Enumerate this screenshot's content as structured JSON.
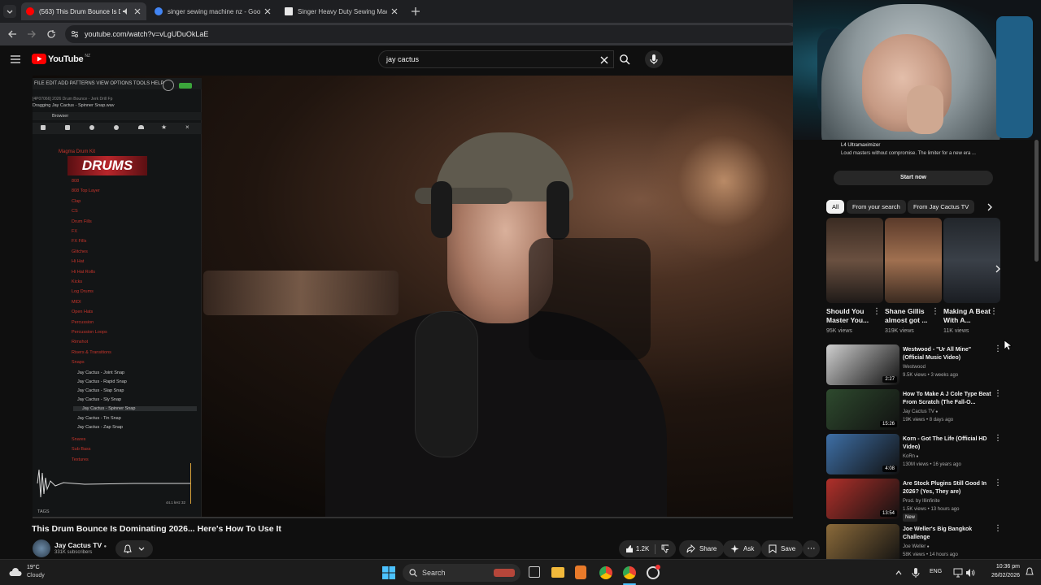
{
  "browser": {
    "tabs": [
      {
        "title": "(563) This Drum Bounce Is D",
        "favicon_color": "#ff0000",
        "active": true
      },
      {
        "title": "singer sewing machine nz - Goo",
        "favicon_color": "#4285f4",
        "active": false
      },
      {
        "title": "Singer Heavy Duty Sewing Mac",
        "favicon_color": "#ffffff",
        "active": false
      }
    ],
    "url": "youtube.com/watch?v=vLgUDuOkLaE"
  },
  "youtube": {
    "logo": "YouTube",
    "region": "NZ",
    "search_value": "jay cactus"
  },
  "daw": {
    "menu": "FILE  EDIT  ADD  PATTERNS  VIEW  OPTIONS  TOOLS  HELP",
    "project": "[4P07066] 2026 Drum Bounce - Jerk Drill Fp",
    "dragging": "Dragging Jay Cactus - Spinner Snap.wav",
    "browser_label": "Browser",
    "kit": "Magma Drum Kit",
    "banner": "DRUMS",
    "folders": [
      "808",
      "808 Top Layer",
      "Clap",
      "CS",
      "Drum Fills",
      "FX",
      "FX Fills",
      "Glitches",
      "Hi Hat",
      "Hi Hat Rolls",
      "Kicks",
      "Log Drums",
      "MIDI",
      "Open Hats",
      "Percussion",
      "Percussion Loops",
      "Rimshot",
      "Risers & Transitions",
      "Snaps"
    ],
    "snaps": [
      "Jay Cactus - Joint Snap",
      "Jay Cactus - Rapid Snap",
      "Jay Cactus - Slap Snap",
      "Jay Cactus - Sly Snap",
      "Jay Cactus - Spinner Snap",
      "Jay Cactus - Tin Snap",
      "Jay Cactus - Zap Snap"
    ],
    "folders_after": [
      "Snares",
      "Sub Bass",
      "Textures"
    ],
    "sample_info": "44.1 kHz 32",
    "tags": "TAGS"
  },
  "ad": {
    "title": "L4 Ultramaximizer",
    "text": "Loud masters without compromise. The limiter for a new era ...",
    "cta": "Start now"
  },
  "chips": [
    "All",
    "From your search",
    "From Jay Cactus TV"
  ],
  "shorts": [
    {
      "title": "Should You Master You...",
      "views": "95K views"
    },
    {
      "title": "Shane Gillis almost got ...",
      "views": "319K views"
    },
    {
      "title": "Making A Beat With A...",
      "views": "11K views"
    }
  ],
  "recommendations": [
    {
      "title": "Westwood - \"Ur All Mine\" (Official Music Video)",
      "channel": "Westwood",
      "meta": "9.5K views • 3 weeks ago",
      "duration": "2:27",
      "thumb_color": "#cfcfcf",
      "verified": false,
      "badge": ""
    },
    {
      "title": "How To Make A J Cole Type Beat From Scratch (The Fall-O...",
      "channel": "Jay Cactus TV",
      "meta": "19K views • 8 days ago",
      "duration": "15:26",
      "thumb_color": "#2e4a2e",
      "verified": true,
      "badge": ""
    },
    {
      "title": "Korn - Got The Life (Official HD Video)",
      "channel": "KoRn",
      "meta": "130M views • 16 years ago",
      "duration": "4:08",
      "thumb_color": "#3e6fa6",
      "verified": true,
      "badge": ""
    },
    {
      "title": "Are Stock Plugins Still Good In 2026? (Yes, They are)",
      "channel": "Prod. by Illinfinite",
      "meta": "1.5K views • 13 hours ago",
      "duration": "13:54",
      "thumb_color": "#b0302a",
      "verified": false,
      "badge": "New"
    },
    {
      "title": "Joe Weller's Big Bangkok Challenge",
      "channel": "Joe Weller",
      "meta": "58K views • 14 hours ago",
      "duration": "",
      "thumb_color": "#8a6a3a",
      "verified": true,
      "badge": ""
    }
  ],
  "video": {
    "title": "This Drum Bounce Is Dominating 2026... Here's How To Use It",
    "channel": "Jay Cactus TV",
    "subscribers": "331K subscribers",
    "likes": "1.2K",
    "share": "Share",
    "ask": "Ask",
    "save": "Save",
    "progress": 0.0
  },
  "taskbar": {
    "weather_temp": "19°C",
    "weather_desc": "Cloudy",
    "search": "Search",
    "language": "ENG",
    "time": "10:36 pm",
    "date": "26/02/2026"
  }
}
